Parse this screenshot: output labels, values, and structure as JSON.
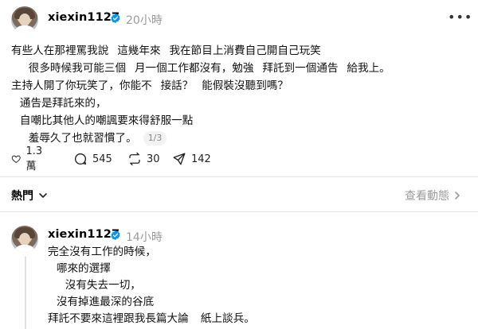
{
  "post1": {
    "username": "xiexin1127",
    "time": "20小時",
    "lines": [
      "有些人在那裡罵我說這幾年來我在節目上消費自己開自己玩笑",
      "很多時候我可能三個月一個工作都沒有，勉強拜託到一個通告給我上。",
      "主持人開了你玩笑了，你能不接話？能假裝沒聽到嗎？",
      "通告是拜託來的，",
      "自嘲比其他人的嘲諷要來得舒服一點",
      "羞辱久了也就習慣了。"
    ],
    "pager": "1/3",
    "stats": {
      "likes": "1.3 萬",
      "comments": "545",
      "reposts": "30",
      "shares": "142"
    }
  },
  "tabs": {
    "hot": "熱門",
    "activity": "查看動態"
  },
  "post2": {
    "username": "xiexin1127",
    "time": "14小時",
    "lines": [
      "完全沒有工作的時候，",
      "哪來的選擇",
      "沒有失去一切，",
      "沒有掉進最深的谷底",
      "拜託不要來這裡跟我長篇大論 紙上談兵。"
    ]
  },
  "icons": {
    "heart": "heart-icon",
    "comment": "comment-icon",
    "repost": "repost-icon",
    "share": "share-icon",
    "verified": "verified-badge-icon",
    "more": "more-icon",
    "chevron": "chevron-down-icon",
    "chevron_right": "chevron-right-icon"
  },
  "colors": {
    "verified": "#0095f6",
    "muted": "#9a9a9a",
    "divider": "#e7e7e7"
  }
}
